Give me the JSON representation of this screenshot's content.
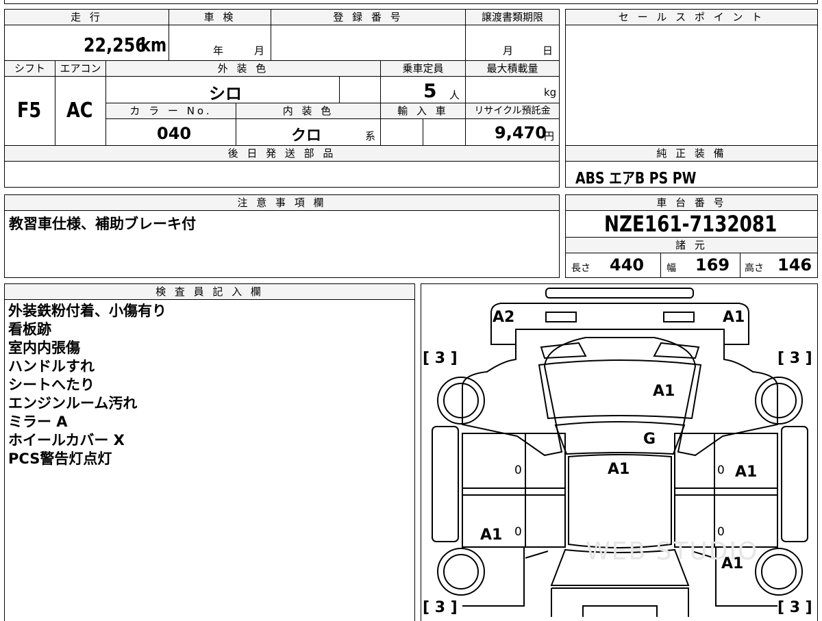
{
  "header": {
    "mileage_label": "走 行",
    "inspection_label": "車 検",
    "registration_label": "登 録 番 号",
    "transfer_deadline_label": "譲渡書類期限",
    "sales_point_label": "セ ー ル ス ポ イ ン ト"
  },
  "vehicle": {
    "mileage_value": "22,256",
    "mileage_unit": "km",
    "inspection_year_unit": "年",
    "inspection_month_unit": "月",
    "transfer_month_unit": "月",
    "transfer_day_unit": "日",
    "shift_label": "シフト",
    "aircon_label": "エアコン",
    "exterior_color_label": "外 装 色",
    "capacity_label": "乗車定員",
    "max_load_label": "最大積載量",
    "shift_value": "F5",
    "aircon_value": "AC",
    "exterior_color_value": "シロ",
    "capacity_value": "5",
    "capacity_unit": "人",
    "max_load_unit": "kg",
    "color_no_label": "カ ラ ー No.",
    "interior_color_label": "内 装 色",
    "import_label": "輸 入 車",
    "recycle_label": "リサイクル預託金",
    "color_no_value": "040",
    "interior_color_value": "クロ",
    "interior_color_suffix": "系",
    "recycle_value": "9,470",
    "recycle_unit": "円",
    "later_parts_label": "後 日 発 送 部 品",
    "genuine_equipment_label": "純 正 装 備",
    "genuine_equipment_value": "ABS エアB PS PW",
    "notes_label": "注 意 事 項 欄",
    "notes_value": "教習車仕様、補助ブレーキ付",
    "chassis_label": "車 台 番 号",
    "chassis_value": "NZE161-7132081",
    "specs_label": "諸 元",
    "length_label": "長さ",
    "length_value": "440",
    "width_label": "幅",
    "width_value": "169",
    "height_label": "高さ",
    "height_value": "146"
  },
  "inspector": {
    "label": "検 査 員 記 入 欄",
    "lines": [
      "外装鉄粉付着、小傷有り",
      "看板跡",
      "室内内張傷",
      "ハンドルすれ",
      "シートへたり",
      "エンジンルーム汚れ",
      "ミラー A",
      "ホイールカバー X",
      "PCS警告灯点灯"
    ]
  },
  "diagram": {
    "marks": {
      "front_left": "A2",
      "front_right": "A1",
      "bonnet": "A1",
      "windshield": "G",
      "roof": "A1",
      "right_front_door": "A1",
      "left_rear": "A1",
      "right_rear": "A1"
    },
    "door_zeros": [
      "0",
      "0",
      "0",
      "0"
    ],
    "tire_tread": [
      "[ 3 ]",
      "[ 3 ]",
      "[ 3 ]",
      "[ 3 ]"
    ],
    "watermark": "WEB STUDIO"
  }
}
